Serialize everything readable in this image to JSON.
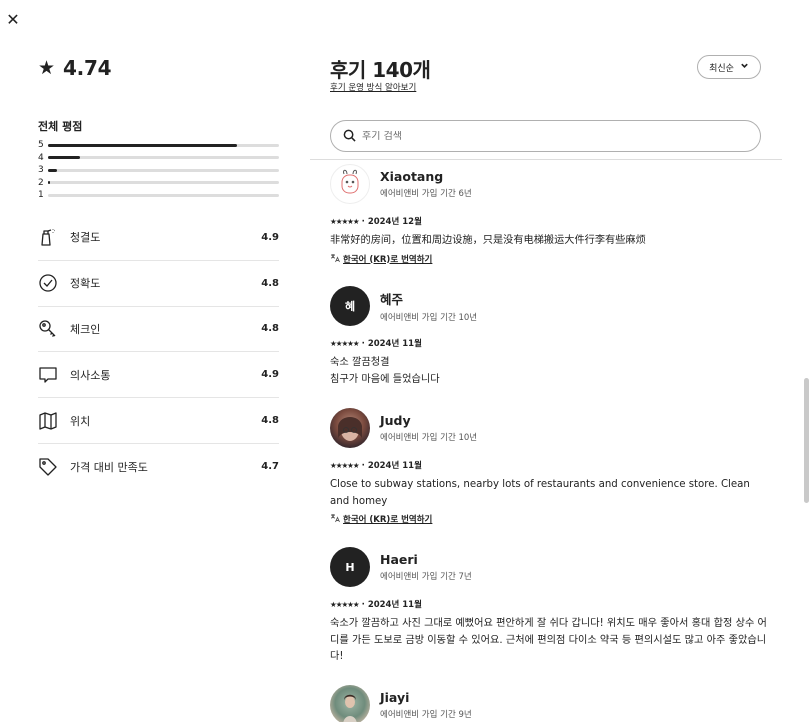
{
  "dialog": {
    "close_icon": "close-icon",
    "close_symbol": "✕"
  },
  "summary": {
    "star_symbol": "★",
    "rating": "4.74",
    "distribution_title": "전체 평점",
    "distribution": [
      {
        "label": "5",
        "fraction": 0.82
      },
      {
        "label": "4",
        "fraction": 0.14
      },
      {
        "label": "3",
        "fraction": 0.04
      },
      {
        "label": "2",
        "fraction": 0.01
      },
      {
        "label": "1",
        "fraction": 0.0
      }
    ],
    "categories": [
      {
        "icon": "spray-bottle-icon",
        "label": "청결도",
        "score": "4.9"
      },
      {
        "icon": "check-circle-icon",
        "label": "정확도",
        "score": "4.8"
      },
      {
        "icon": "key-icon",
        "label": "체크인",
        "score": "4.8"
      },
      {
        "icon": "message-icon",
        "label": "의사소통",
        "score": "4.9"
      },
      {
        "icon": "map-icon",
        "label": "위치",
        "score": "4.8"
      },
      {
        "icon": "tag-icon",
        "label": "가격 대비 만족도",
        "score": "4.7"
      }
    ]
  },
  "reviews_header": {
    "title": "후기 140개",
    "how_link": "후기 운영 방식 알아보기",
    "sort_label": "최신순",
    "sort_chevron": "⌄"
  },
  "search": {
    "placeholder": "후기 검색",
    "value": ""
  },
  "colors": {
    "text": "#222222",
    "muted": "#717171",
    "track": "#dddddd",
    "avatar_dark": "#222222"
  },
  "reviews": [
    {
      "name": "Xiaotang",
      "meta": "에어비앤비 가입 기간 6년",
      "avatar_type": "illustration",
      "avatar_letter": "",
      "stars": "★★★★★",
      "date": "· 2024년 12월",
      "text": "非常好的房间，位置和周边设施，只是没有电梯搬运大件行李有些麻烦",
      "translate": "한국어 (KR)로 번역하기"
    },
    {
      "name": "혜주",
      "meta": "에어비앤비 가입 기간 10년",
      "avatar_type": "letter",
      "avatar_letter": "혜",
      "stars": "★★★★★",
      "date": "· 2024년 11월",
      "text": "숙소 깔끔청결\n침구가 마음에 들었습니다",
      "translate": ""
    },
    {
      "name": "Judy",
      "meta": "에어비앤비 가입 기간 10년",
      "avatar_type": "photo",
      "avatar_letter": "",
      "stars": "★★★★★",
      "date": "· 2024년 11월",
      "text": "Close to subway stations, nearby lots of restaurants and convenience store. Clean and homey",
      "translate": "한국어 (KR)로 번역하기"
    },
    {
      "name": "Haeri",
      "meta": "에어비앤비 가입 기간 7년",
      "avatar_type": "letter",
      "avatar_letter": "H",
      "stars": "★★★★★",
      "date": "· 2024년 11월",
      "text": "숙소가 깔끔하고 사진 그대로 예뻤어요 편안하게 잘 쉬다 갑니다! 위치도 매우 좋아서 홍대 합정 상수 어디를 가든 도보로 금방 이동할 수 있어요. 근처에 편의점 다이소 약국 등 편의시설도 많고 아주 좋았습니다!",
      "translate": ""
    },
    {
      "name": "Jiayi",
      "meta": "에어비앤비 가입 기간 9년",
      "avatar_type": "photo2",
      "avatar_letter": "",
      "stars": "",
      "date": "",
      "text": "",
      "translate": ""
    }
  ]
}
